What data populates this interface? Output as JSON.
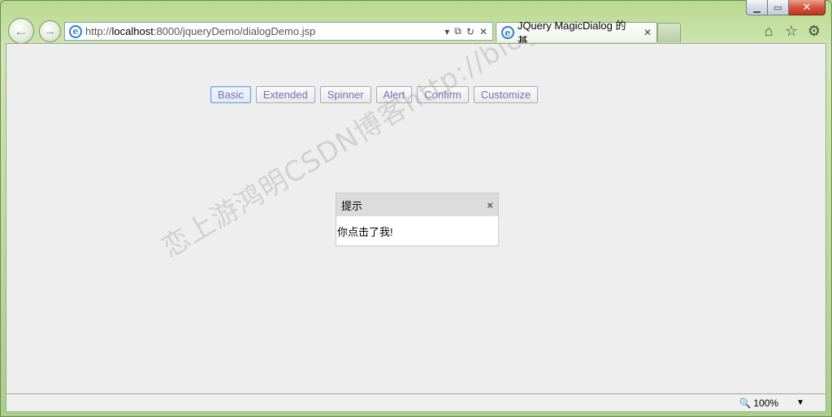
{
  "browser": {
    "url_prefix": "http://",
    "url_host": "localhost",
    "url_rest": ":8000/jqueryDemo/dialogDemo.jsp",
    "tab_title": "JQuery MagicDialog 的基...",
    "tab_close": "✕",
    "back_icon": "←",
    "forward_icon": "→",
    "address_tools": {
      "dropdown": "▾",
      "compat": "⧉",
      "refresh": "↻",
      "stop": "✕"
    },
    "right_icons": {
      "home": "⌂",
      "favorites": "☆",
      "tools": "⚙"
    },
    "window_controls": {
      "minimize": "▁",
      "maximize": "▭",
      "close": "✕"
    }
  },
  "page": {
    "buttons": [
      "Basic",
      "Extended",
      "Spinner",
      "Alert",
      "Confirm",
      "Customize"
    ],
    "dialog": {
      "title": "提示",
      "close": "×",
      "message": "你点击了我!"
    },
    "watermark": "恋上游鸿明CSDN博客http://blog.csdn.net/youqishini"
  },
  "status": {
    "zoom": "100%",
    "zoom_dropdown": "▼"
  }
}
